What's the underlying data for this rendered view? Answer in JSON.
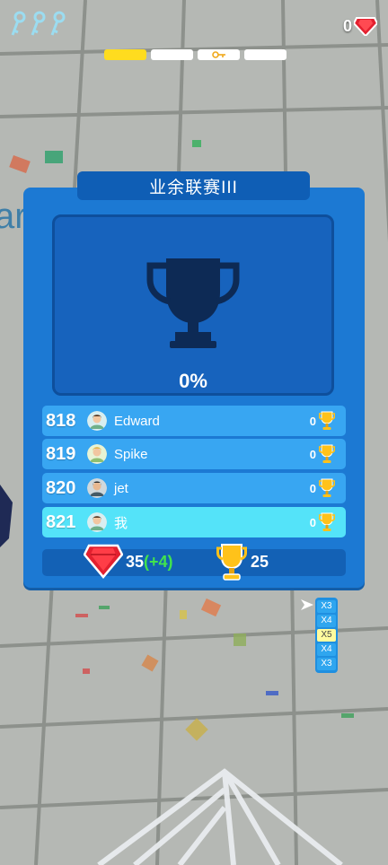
{
  "hud": {
    "key_icons": [
      "key-icon",
      "key-icon",
      "key-icon"
    ],
    "gem_count": "0",
    "progress_segments": [
      {
        "state": "active"
      },
      {
        "state": "empty"
      },
      {
        "state": "key"
      },
      {
        "state": "empty"
      }
    ]
  },
  "league": {
    "title": "业余联赛III",
    "progress_pct": "0%",
    "leaderboard": [
      {
        "rank": "818",
        "name": "Edward",
        "score": "0",
        "avatar_color": "#6fb08a"
      },
      {
        "rank": "819",
        "name": "Spike",
        "score": "0",
        "avatar_color": "#8fbf70"
      },
      {
        "rank": "820",
        "name": "jet",
        "score": "0",
        "avatar_color": "#455a66"
      },
      {
        "rank": "821",
        "name": "我",
        "score": "0",
        "avatar_color": "#6fb08a"
      }
    ],
    "reward": {
      "gems": "35",
      "gem_bonus": "(+4)",
      "cups": "25"
    }
  },
  "multiplier": [
    "X3",
    "X4",
    "X5",
    "X4",
    "X3"
  ],
  "colors": {
    "panel": "#1c79d3",
    "row": "#38a6f2",
    "row_me": "#54e3f9",
    "accent_yellow": "#ffdc1f",
    "bonus_green": "#41e34d",
    "gem_red": "#e3202f"
  }
}
